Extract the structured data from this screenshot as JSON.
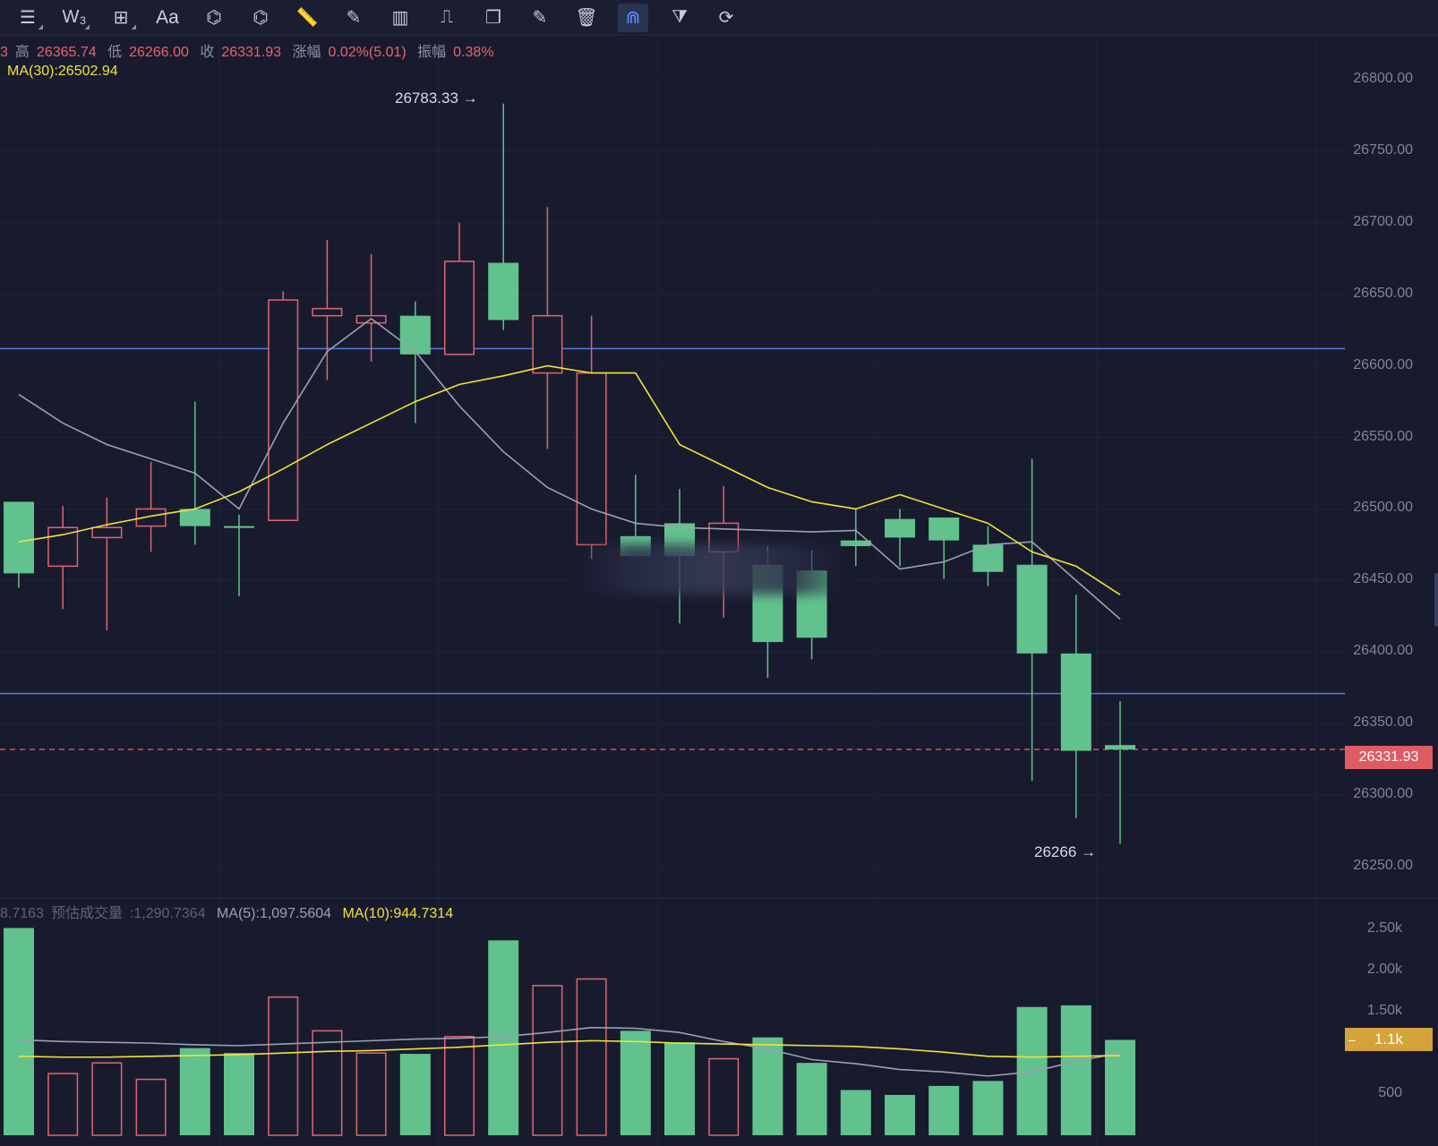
{
  "toolbar": {
    "tools": [
      {
        "name": "menu-icon",
        "glyph": "☰"
      },
      {
        "name": "wave-tool-icon",
        "glyph": "W₃"
      },
      {
        "name": "add-indicator-icon",
        "glyph": "⊞"
      },
      {
        "name": "text-tool-icon",
        "glyph": "Aa"
      },
      {
        "name": "pattern-tool-icon",
        "glyph": "⌬"
      },
      {
        "name": "crosshair-tool-icon",
        "glyph": "⌬"
      },
      {
        "name": "ruler-icon",
        "glyph": "📏"
      },
      {
        "name": "brush-icon",
        "glyph": "✎"
      },
      {
        "name": "candle-settings-icon",
        "glyph": "▥"
      },
      {
        "name": "lock-icon",
        "glyph": "⎍"
      },
      {
        "name": "copy-icon",
        "glyph": "❐"
      },
      {
        "name": "notes-icon",
        "glyph": "✎"
      },
      {
        "name": "delete-icon",
        "glyph": "🗑"
      },
      {
        "name": "magnet-icon",
        "glyph": "⋒"
      },
      {
        "name": "filter-icon",
        "glyph": "⧩"
      },
      {
        "name": "sync-icon",
        "glyph": "⟳"
      }
    ]
  },
  "info": {
    "o_tail": "3",
    "high_label": "高",
    "high": "26365.74",
    "low_label": "低",
    "low": "26266.00",
    "close_label": "收",
    "close": "26331.93",
    "change_label": "涨幅",
    "change": "0.02%(5.01)",
    "amp_label": "振幅",
    "amp": "0.38%",
    "ma30": "MA(30):26502.94"
  },
  "volume_info": {
    "vol_tail": "8.7163",
    "est_label": "预估成交量",
    "est": ":1,290.7364",
    "ma5": "MA(5):1,097.5604",
    "ma10": "MA(10):944.7314"
  },
  "annotations": {
    "high_mark": "26783.33 →",
    "low_mark": "26266 →"
  },
  "price_axis": [
    "26800.00",
    "26750.00",
    "26700.00",
    "26650.00",
    "26600.00",
    "26550.00",
    "26500.00",
    "26450.00",
    "26400.00",
    "26350.00",
    "26300.00",
    "26250.00"
  ],
  "current_price_tag": "26331.93",
  "volume_axis": [
    "2.50k",
    "2.00k",
    "1.50k",
    "500"
  ],
  "volume_tag": "1.1k",
  "volume_tag_prefix": "–",
  "colors": {
    "up": "#62c28d",
    "down": "#e0656c",
    "ma_short": "#9aa0b4",
    "ma_long": "#f0e23a",
    "hline": "#4f7fe0",
    "bg": "#181b2e"
  },
  "chart_data": {
    "type": "candlestick",
    "price_range": [
      26230,
      26830
    ],
    "volume_range": [
      0,
      2700
    ],
    "horizontal_lines": [
      26612,
      26371
    ],
    "current_price": 26331.93,
    "candles": [
      {
        "o": 26455,
        "h": 26505,
        "l": 26445,
        "c": 26505,
        "v": 2520
      },
      {
        "o": 26487,
        "h": 26502,
        "l": 26430,
        "c": 26460,
        "v": 750
      },
      {
        "o": 26487,
        "h": 26508,
        "l": 26415,
        "c": 26480,
        "v": 880
      },
      {
        "o": 26500,
        "h": 26533,
        "l": 26470,
        "c": 26488,
        "v": 680
      },
      {
        "o": 26488,
        "h": 26575,
        "l": 26475,
        "c": 26500,
        "v": 1060
      },
      {
        "o": 26487,
        "h": 26496,
        "l": 26439,
        "c": 26488,
        "v": 1000
      },
      {
        "o": 26646,
        "h": 26652,
        "l": 26492,
        "c": 26492,
        "v": 1680
      },
      {
        "o": 26640,
        "h": 26688,
        "l": 26590,
        "c": 26635,
        "v": 1270
      },
      {
        "o": 26635,
        "h": 26678,
        "l": 26603,
        "c": 26630,
        "v": 1000
      },
      {
        "o": 26608,
        "h": 26645,
        "l": 26560,
        "c": 26635,
        "v": 990
      },
      {
        "o": 26673,
        "h": 26700,
        "l": 26608,
        "c": 26608,
        "v": 1200
      },
      {
        "o": 26632,
        "h": 26783.33,
        "l": 26625,
        "c": 26672,
        "v": 2370
      },
      {
        "o": 26635,
        "h": 26711,
        "l": 26542,
        "c": 26595,
        "v": 1820
      },
      {
        "o": 26595,
        "h": 26635,
        "l": 26465,
        "c": 26475,
        "v": 1900
      },
      {
        "o": 26467,
        "h": 26524,
        "l": 26468,
        "c": 26481,
        "v": 1270
      },
      {
        "o": 26467,
        "h": 26514,
        "l": 26420,
        "c": 26490,
        "v": 1130
      },
      {
        "o": 26490,
        "h": 26516,
        "l": 26424,
        "c": 26470,
        "v": 930
      },
      {
        "o": 26407,
        "h": 26474,
        "l": 26382,
        "c": 26461,
        "v": 1190
      },
      {
        "o": 26410,
        "h": 26471,
        "l": 26395,
        "c": 26457,
        "v": 880
      },
      {
        "o": 26474,
        "h": 26500,
        "l": 26460,
        "c": 26478,
        "v": 550
      },
      {
        "o": 26480,
        "h": 26500,
        "l": 26460,
        "c": 26493,
        "v": 490
      },
      {
        "o": 26478,
        "h": 26492,
        "l": 26451,
        "c": 26494,
        "v": 600
      },
      {
        "o": 26456,
        "h": 26488,
        "l": 26446,
        "c": 26475,
        "v": 660
      },
      {
        "o": 26399,
        "h": 26535,
        "l": 26310,
        "c": 26461,
        "v": 1560
      },
      {
        "o": 26331,
        "h": 26440,
        "l": 26284,
        "c": 26399,
        "v": 1580
      },
      {
        "o": 26331.9,
        "h": 26365.74,
        "l": 26266,
        "c": 26335,
        "v": 1160
      }
    ],
    "ma_short": [
      26580,
      26560,
      26545,
      26535,
      26525,
      26500,
      26560,
      26610,
      26633,
      26610,
      26572,
      26540,
      26515,
      26500,
      26490,
      26487,
      26486,
      26485,
      26484,
      26485,
      26458,
      26463,
      26475,
      26477,
      26450,
      26423
    ],
    "ma_long": [
      26477,
      26482,
      26489,
      26495,
      26500,
      26512,
      26528,
      26545,
      26560,
      26575,
      26587,
      26593,
      26600,
      26595,
      26595,
      26545,
      26530,
      26515,
      26505,
      26500,
      26510,
      26500,
      26490,
      26470,
      26460,
      26440
    ],
    "vol_ma_short": [
      1160,
      1140,
      1130,
      1120,
      1100,
      1090,
      1110,
      1130,
      1150,
      1170,
      1180,
      1200,
      1250,
      1310,
      1300,
      1250,
      1140,
      1050,
      920,
      870,
      800,
      770,
      720,
      770,
      900,
      1000
    ],
    "vol_ma_long": [
      960,
      950,
      950,
      960,
      970,
      980,
      1000,
      1020,
      1030,
      1050,
      1070,
      1100,
      1130,
      1150,
      1140,
      1120,
      1110,
      1100,
      1090,
      1080,
      1050,
      1010,
      960,
      950,
      960,
      970
    ]
  }
}
